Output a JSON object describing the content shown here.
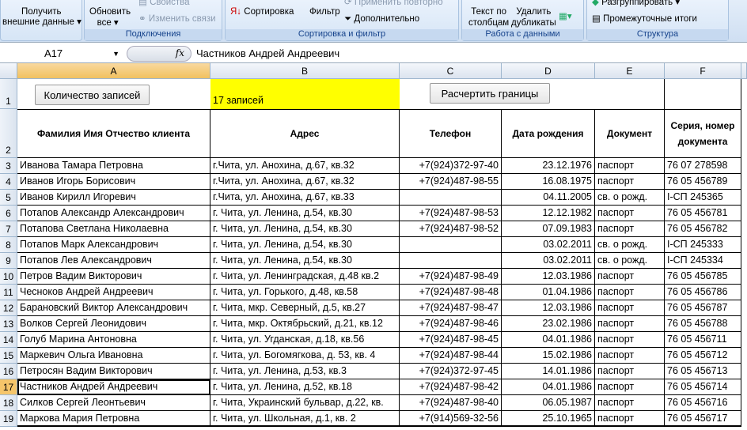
{
  "ribbon": {
    "get_external": [
      "Получить",
      "внешние данные"
    ],
    "refresh": [
      "Обновить",
      "все"
    ],
    "properties": "Свойства",
    "edit_links": "Изменить связи",
    "group_connections": "Подключения",
    "sort": "Сортировка",
    "filter": "Фильтр",
    "reapply": "Применить повторно",
    "advanced": "Дополнительно",
    "group_sort": "Сортировка и фильтр",
    "text_to_columns": [
      "Текст по",
      "столбцам"
    ],
    "remove_dup": [
      "Удалить",
      "дубликаты"
    ],
    "group_data": "Работа с данными",
    "ungroup": "Разгруппировать",
    "subtotal": "Промежуточные итоги",
    "group_outline": "Структура"
  },
  "formula": {
    "name_box": "A17",
    "fx": "fx",
    "value": "Частников Андрей Андреевич"
  },
  "columns": [
    "A",
    "B",
    "C",
    "D",
    "E",
    "F"
  ],
  "row1": {
    "count_button": "Количество записей",
    "count_value": "17 записей",
    "borders_button": "Расчертить границы"
  },
  "headers": [
    "Фамилия Имя Отчество клиента",
    "Адрес",
    "Телефон",
    "Дата рождения",
    "Документ",
    "Серия, номер документа"
  ],
  "rows": [
    [
      "3",
      "Иванова Тамара Петровна",
      "г.Чита, ул. Анохина, д.67, кв.32",
      "+7(924)372-97-40",
      "23.12.1976",
      "паспорт",
      "76 07 278598"
    ],
    [
      "4",
      "Иванов Игорь Борисович",
      "г.Чита, ул. Анохина, д.67, кв.32",
      "+7(924)487-98-55",
      "16.08.1975",
      "паспорт",
      "76 05 456789"
    ],
    [
      "5",
      "Иванов Кирилл Игоревич",
      "г.Чита, ул. Анохина, д.67, кв.33",
      "",
      "04.11.2005",
      "св. о рожд.",
      "I-СП 245365"
    ],
    [
      "6",
      "Потапов Александр Александрович",
      "г. Чита, ул. Ленина, д.54, кв.30",
      "+7(924)487-98-53",
      "12.12.1982",
      "паспорт",
      "76 05 456781"
    ],
    [
      "7",
      "Потапова Светлана Николаевна",
      "г. Чита, ул. Ленина, д.54, кв.30",
      "+7(924)487-98-52",
      "07.09.1983",
      "паспорт",
      "76 05 456782"
    ],
    [
      "8",
      "Потапов Марк Александрович",
      "г. Чита, ул. Ленина, д.54, кв.30",
      "",
      "03.02.2011",
      "св. о рожд.",
      "I-СП 245333"
    ],
    [
      "9",
      "Потапов Лев Александрович",
      "г. Чита, ул. Ленина, д.54, кв.30",
      "",
      "03.02.2011",
      "св. о рожд.",
      "I-СП 245334"
    ],
    [
      "10",
      "Петров Вадим Викторович",
      "г. Чита, ул. Ленинградская, д.48 кв.2",
      "+7(924)487-98-49",
      "12.03.1986",
      "паспорт",
      "76 05 456785"
    ],
    [
      "11",
      "Чесноков Андрей Андреевич",
      "г. Чита, ул. Горького, д.48, кв.58",
      "+7(924)487-98-48",
      "01.04.1986",
      "паспорт",
      "76 05 456786"
    ],
    [
      "12",
      "Барановский Виктор Александрович",
      "г. Чита, мкр. Северный, д.5, кв.27",
      "+7(924)487-98-47",
      "12.03.1986",
      "паспорт",
      "76 05 456787"
    ],
    [
      "13",
      "Волков Сергей Леонидович",
      "г. Чита, мкр. Октябрьский, д.21, кв.12",
      "+7(924)487-98-46",
      "23.02.1986",
      "паспорт",
      "76 05 456788"
    ],
    [
      "14",
      "Голуб Марина Антоновна",
      "г. Чита, ул. Угданская, д.18, кв.56",
      "+7(924)487-98-45",
      "04.01.1986",
      "паспорт",
      "76 05 456711"
    ],
    [
      "15",
      "Маркевич Ольга Ивановна",
      "г. Чита, ул. Богомягкова, д. 53, кв. 4",
      "+7(924)487-98-44",
      "15.02.1986",
      "паспорт",
      "76 05 456712"
    ],
    [
      "16",
      "Петросян Вадим Викторович",
      "г. Чита, ул. Ленина, д.53, кв.3",
      "+7(924)372-97-45",
      "14.01.1986",
      "паспорт",
      "76 05 456713"
    ],
    [
      "17",
      "Частников Андрей Андреевич",
      "г. Чита, ул. Ленина, д.52, кв.18",
      "+7(924)487-98-42",
      "04.01.1986",
      "паспорт",
      "76 05 456714"
    ],
    [
      "18",
      "Силков Сергей Леонтьевич",
      "г. Чита, Украинский бульвар, д.22, кв.",
      "+7(924)487-98-40",
      "06.05.1987",
      "паспорт",
      "76 05 456716"
    ],
    [
      "19",
      "Маркова Мария Петровна",
      "г. Чита, ул. Школьная, д.1, кв. 2",
      "+7(914)569-32-56",
      "25.10.1965",
      "паспорт",
      "76 05 456717"
    ]
  ],
  "selected_row": "17",
  "colors": {
    "highlight": "#ffff00",
    "selection_header": "#f5c56a"
  }
}
